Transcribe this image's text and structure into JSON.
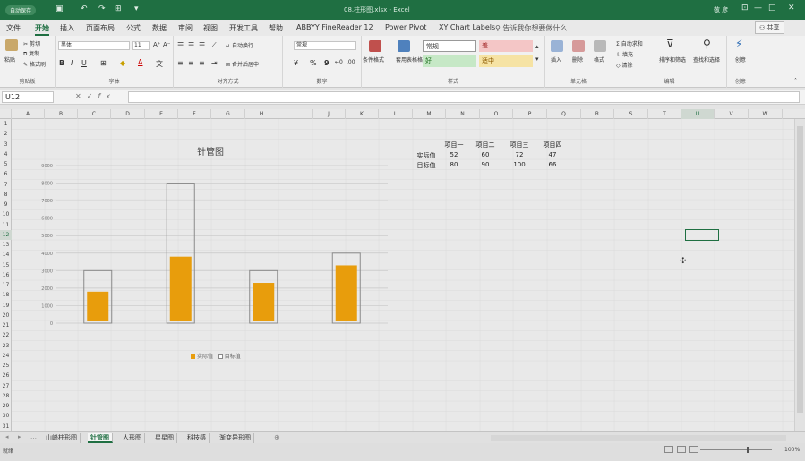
{
  "titlebar": {
    "autosave": "自动保存",
    "doc_title": "08.柱形图.xlsx - Excel",
    "user": "敬 彦",
    "win_min": "—",
    "win_restore": "▭",
    "win_max": "□",
    "win_close": "✕"
  },
  "tabs": [
    "文件",
    "开始",
    "插入",
    "页面布局",
    "公式",
    "数据",
    "审阅",
    "视图",
    "开发工具",
    "帮助",
    "ABBYY FineReader 12",
    "Power Pivot",
    "XY Chart Labels"
  ],
  "active_tab": "开始",
  "tell_me": "告诉我你想要做什么",
  "share": "共享",
  "ribbon": {
    "clipboard": {
      "label": "剪贴板",
      "paste": "粘贴",
      "cut": "剪切",
      "copy": "复制",
      "format_painter": "格式刷"
    },
    "font": {
      "label": "字体",
      "font_name": "黑体",
      "font_size": "11",
      "bold": "B",
      "italic": "I",
      "underline": "U"
    },
    "alignment": {
      "label": "对齐方式",
      "wrap": "自动换行",
      "merge": "合并后居中"
    },
    "number": {
      "label": "数字",
      "format": "常规",
      "percent": "%",
      "comma": "9"
    },
    "styles": {
      "label": "样式",
      "cond_format": "条件格式",
      "table_format": "套用表格格式",
      "normal": "常规",
      "bad": "差",
      "good": "好",
      "neutral": "适中"
    },
    "cells": {
      "label": "单元格",
      "insert": "插入",
      "delete": "删除",
      "format": "格式"
    },
    "editing": {
      "label": "编辑",
      "autosum": "自动求和",
      "fill": "填充",
      "clear": "清除",
      "sort": "排序和筛选",
      "find": "查找和选择"
    },
    "create": {
      "label": "创意",
      "idea": "创意"
    }
  },
  "formula_bar": {
    "name_box": "U12",
    "cancel": "✕",
    "enter": "✓",
    "fx": "fx"
  },
  "columns": [
    "A",
    "B",
    "C",
    "D",
    "E",
    "F",
    "G",
    "H",
    "I",
    "J",
    "K",
    "L",
    "M",
    "N",
    "O",
    "P",
    "Q",
    "R",
    "S",
    "T",
    "U",
    "V",
    "W"
  ],
  "rows": [
    "1",
    "2",
    "3",
    "4",
    "5",
    "6",
    "7",
    "8",
    "9",
    "10",
    "11",
    "12",
    "13",
    "14",
    "15",
    "16",
    "17",
    "18",
    "19",
    "20",
    "21",
    "22",
    "23",
    "24",
    "25",
    "26",
    "27",
    "28",
    "29",
    "30",
    "31"
  ],
  "selected_col": "U",
  "selected_row": "12",
  "table": {
    "headers": [
      "项目一",
      "项目二",
      "项目三",
      "项目四"
    ],
    "rows": [
      {
        "label": "实际值",
        "values": [
          "52",
          "60",
          "72",
          "47"
        ]
      },
      {
        "label": "目标值",
        "values": [
          "80",
          "90",
          "100",
          "66"
        ]
      }
    ]
  },
  "chart_data": {
    "type": "bar",
    "title": "针管图",
    "categories": [
      "",
      "",
      "",
      ""
    ],
    "series": [
      {
        "name": "实际值",
        "values": [
          1800,
          3800,
          2300,
          3300
        ],
        "color": "#e89d0c"
      },
      {
        "name": "目标值",
        "values": [
          3000,
          8000,
          3000,
          4000
        ],
        "color": "#ffffff"
      }
    ],
    "ylim": [
      0,
      9000
    ],
    "yticks": [
      "0",
      "1000",
      "2000",
      "3000",
      "4000",
      "5000",
      "6000",
      "7000",
      "8000",
      "9000"
    ],
    "grid": true,
    "legend": "bottom"
  },
  "sheet_tabs": [
    "山峰柱形图",
    "针管图",
    "人形图",
    "星星图",
    "科技感",
    "渐变异形图"
  ],
  "active_sheet": "针管图",
  "add_sheet": "⊕",
  "status": {
    "ready": "就绪",
    "zoom": "100%"
  }
}
